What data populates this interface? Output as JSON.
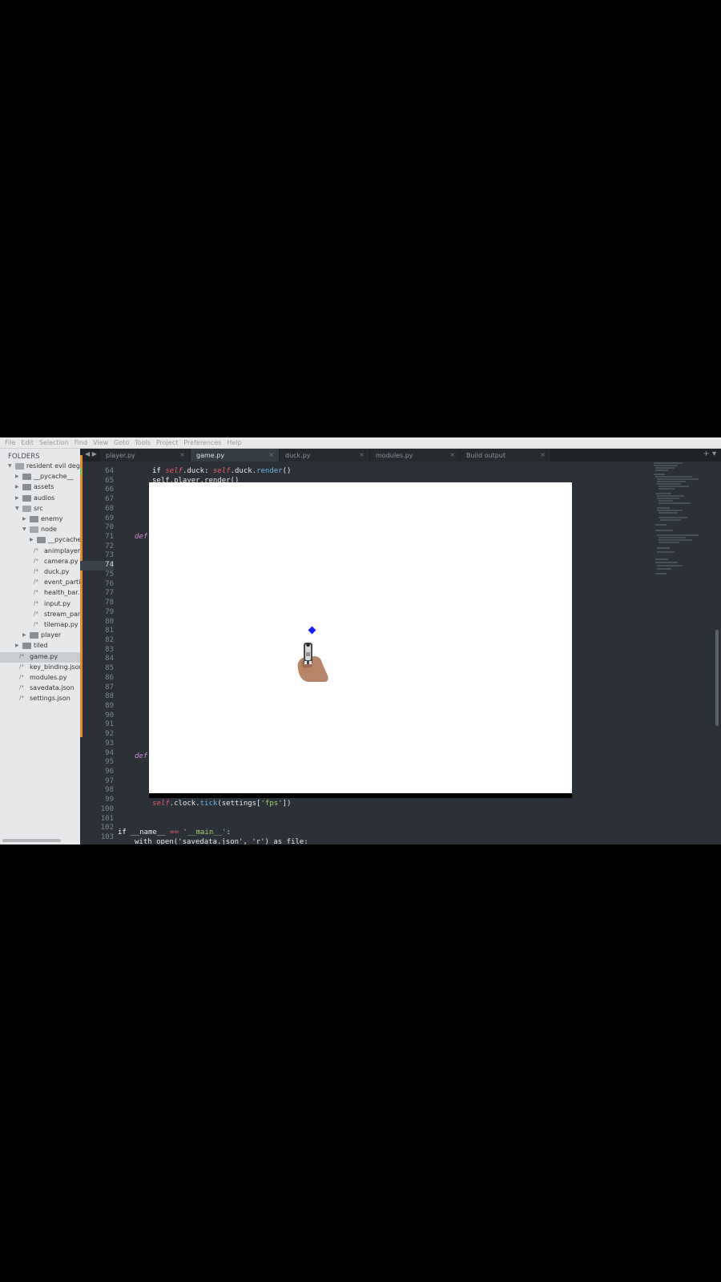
{
  "menu": [
    "File",
    "Edit",
    "Selection",
    "Find",
    "View",
    "Goto",
    "Tools",
    "Project",
    "Preferences",
    "Help"
  ],
  "sidebar": {
    "header": "FOLDERS",
    "items": [
      {
        "label": "resident evil degen",
        "type": "folder",
        "open": true,
        "depth": 0
      },
      {
        "label": "__pycache__",
        "type": "folder",
        "open": false,
        "depth": 1
      },
      {
        "label": "assets",
        "type": "folder",
        "open": false,
        "depth": 1
      },
      {
        "label": "audios",
        "type": "folder",
        "open": false,
        "depth": 1
      },
      {
        "label": "src",
        "type": "folder",
        "open": true,
        "depth": 1
      },
      {
        "label": "enemy",
        "type": "folder",
        "open": false,
        "depth": 2
      },
      {
        "label": "node",
        "type": "folder",
        "open": true,
        "depth": 2
      },
      {
        "label": "__pycache__",
        "type": "folder",
        "open": false,
        "depth": 3
      },
      {
        "label": "animplayer.p",
        "type": "file",
        "depth": 3
      },
      {
        "label": "camera.py",
        "type": "file",
        "depth": 3
      },
      {
        "label": "duck.py",
        "type": "file",
        "depth": 3
      },
      {
        "label": "event_particl",
        "type": "file",
        "depth": 3
      },
      {
        "label": "health_bar.py",
        "type": "file",
        "depth": 3
      },
      {
        "label": "input.py",
        "type": "file",
        "depth": 3
      },
      {
        "label": "stream_parti",
        "type": "file",
        "depth": 3
      },
      {
        "label": "tilemap.py",
        "type": "file",
        "depth": 3
      },
      {
        "label": "player",
        "type": "folder",
        "open": false,
        "depth": 2
      },
      {
        "label": "tiled",
        "type": "folder",
        "open": false,
        "depth": 1
      },
      {
        "label": "game.py",
        "type": "file",
        "depth": 1,
        "selected": true
      },
      {
        "label": "key_binding.json",
        "type": "file",
        "depth": 1
      },
      {
        "label": "modules.py",
        "type": "file",
        "depth": 1
      },
      {
        "label": "savedata.json",
        "type": "file",
        "depth": 1
      },
      {
        "label": "settings.json",
        "type": "file",
        "depth": 1
      }
    ]
  },
  "tabs": [
    {
      "label": "player.py",
      "active": false
    },
    {
      "label": "game.py",
      "active": true
    },
    {
      "label": "duck.py",
      "active": false
    },
    {
      "label": "modules.py",
      "active": false
    },
    {
      "label": "Build output",
      "active": false
    }
  ],
  "tab_close_glyph": "×",
  "line_numbers": [
    64,
    65,
    66,
    67,
    68,
    69,
    70,
    71,
    72,
    73,
    74,
    75,
    76,
    77,
    78,
    79,
    80,
    81,
    82,
    83,
    84,
    85,
    86,
    87,
    88,
    89,
    90,
    91,
    92,
    93,
    94,
    95,
    96,
    97,
    98,
    99,
    100,
    101,
    102,
    103
  ],
  "current_line": 74,
  "code": {
    "l64_if": "if ",
    "l64_self1": "self",
    "l64_mid": ".duck: ",
    "l64_self2": "self",
    "l64_dot": ".duck.",
    "l64_fn": "render",
    "l64_end": "()",
    "l65": "self.player.render()",
    "def1": "def",
    "def2": "def",
    "l99_self": "self",
    "l99_mid": ".clock.",
    "l99_fn": "tick",
    "l99_arg1": "(settings[",
    "l99_str": "'fps'",
    "l99_end": "])",
    "l102_if": "if ",
    "l102_name": "__name__",
    "l102_eq": " == ",
    "l102_str": "'__main__'",
    "l102_colon": ":",
    "l103": "with open('savedata.json', 'r') as file:"
  },
  "colors": {
    "accent_modified": "#e88b2a",
    "editor_bg": "#2b3137",
    "self": "#e8586b",
    "function": "#6fb4e8",
    "string": "#a5d36e",
    "def": "#d08ad8",
    "duck_dot": "#1a1aff"
  }
}
